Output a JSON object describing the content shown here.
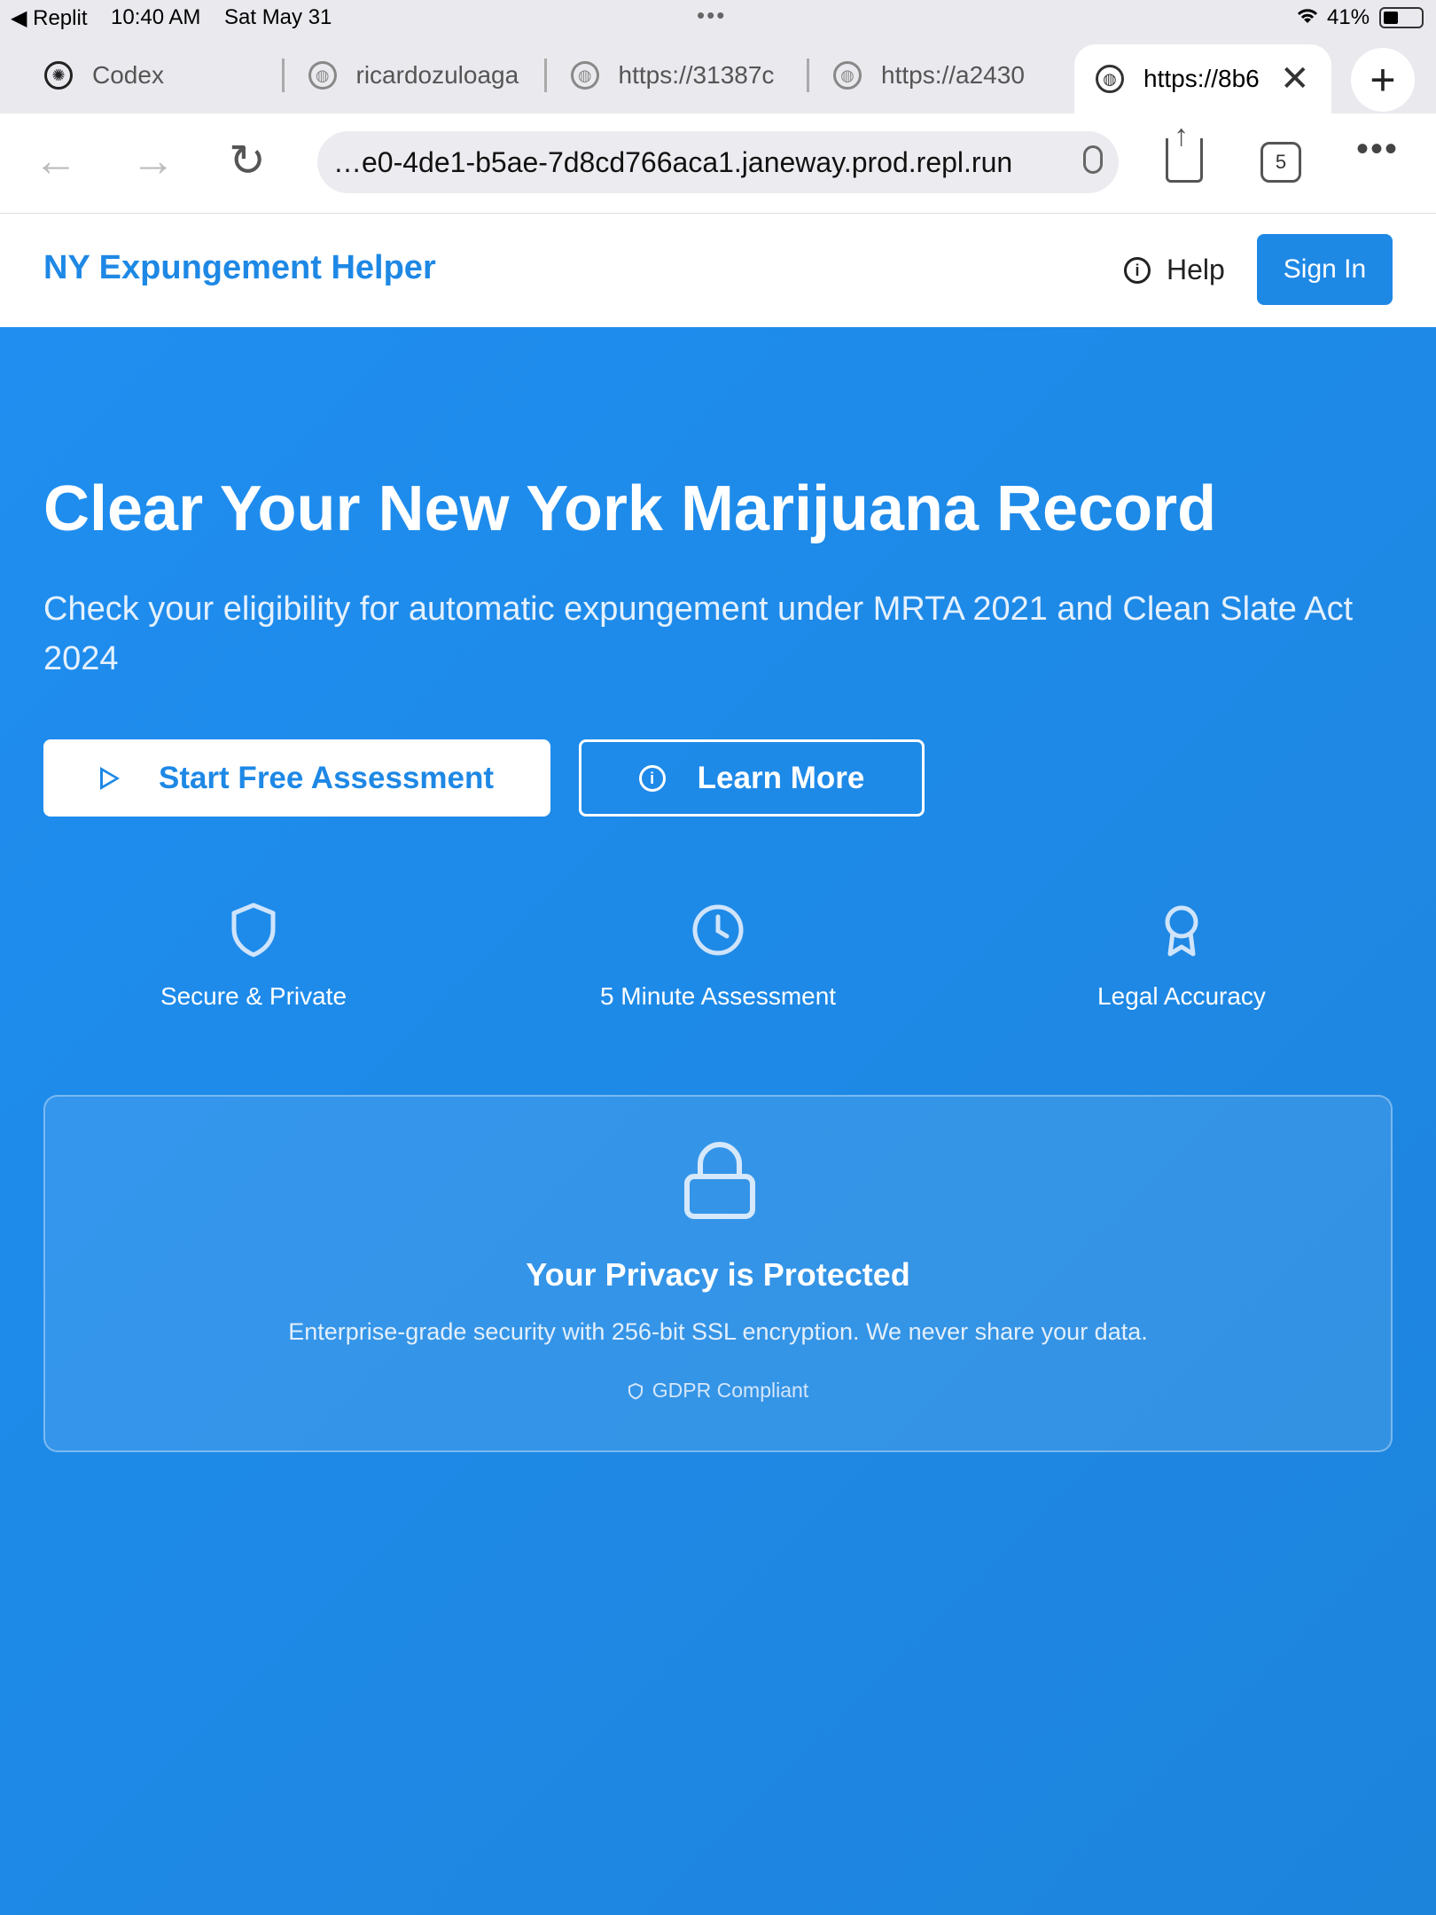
{
  "status_bar": {
    "back_app": "◀ Replit",
    "time": "10:40 AM",
    "date": "Sat May 31",
    "battery": "41%"
  },
  "browser": {
    "tabs": [
      {
        "label": "Codex"
      },
      {
        "label": "ricardozuloaga"
      },
      {
        "label": "https://31387c"
      },
      {
        "label": "https://a2430"
      },
      {
        "label": "https://8b6"
      }
    ],
    "url": "…e0-4de1-b5ae-7d8cd766aca1.janeway.prod.repl.run",
    "tab_count": "5"
  },
  "header": {
    "brand": "NY Expungement Helper",
    "help_label": "Help",
    "sign_in_label": "Sign In"
  },
  "hero": {
    "title": "Clear Your New York Marijuana Record",
    "subtitle": "Check your eligibility for automatic expungement under MRTA 2021 and Clean Slate Act 2024",
    "primary_button": "Start Free Assessment",
    "secondary_button": "Learn More"
  },
  "features": [
    {
      "label": "Secure & Private",
      "icon": "shield-icon"
    },
    {
      "label": "5 Minute Assessment",
      "icon": "clock-icon"
    },
    {
      "label": "Legal Accuracy",
      "icon": "award-icon"
    }
  ],
  "privacy": {
    "title": "Your Privacy is Protected",
    "text": "Enterprise-grade security with 256-bit SSL encryption. We never share your data.",
    "badge": "GDPR Compliant"
  },
  "colors": {
    "accent": "#1e88e5",
    "white": "#ffffff"
  }
}
